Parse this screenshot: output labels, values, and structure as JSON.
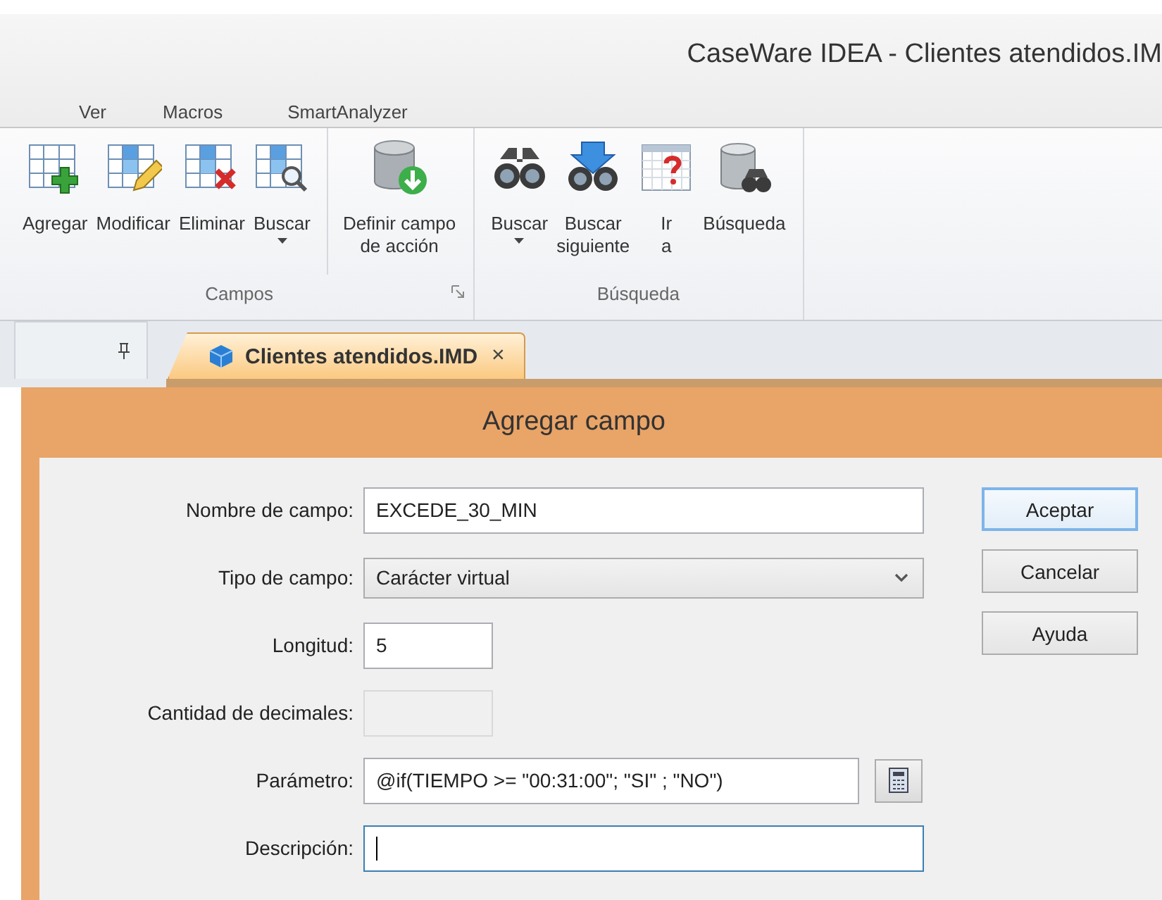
{
  "window": {
    "title": "CaseWare IDEA - Clientes atendidos.IM"
  },
  "menu": [
    "Ver",
    "Macros",
    "SmartAnalyzer"
  ],
  "ribbon": {
    "groups": [
      {
        "label": "Campos",
        "launcher": true,
        "sections": [
          {
            "buttons": [
              {
                "label": "Agregar",
                "has_menu": false
              },
              {
                "label": "Modificar",
                "has_menu": false
              },
              {
                "label": "Eliminar",
                "has_menu": false
              },
              {
                "label": "Buscar",
                "has_menu": true
              }
            ]
          },
          {
            "buttons": [
              {
                "label": "Definir campo\nde acción",
                "has_menu": false
              }
            ]
          }
        ]
      },
      {
        "label": "Búsqueda",
        "sections": [
          {
            "buttons": [
              {
                "label": "Buscar",
                "has_menu": true
              },
              {
                "label": "Buscar\nsiguiente",
                "has_menu": false
              },
              {
                "label": "Ir\na",
                "has_menu": false
              },
              {
                "label": "Búsqueda",
                "has_menu": false
              }
            ]
          }
        ]
      }
    ]
  },
  "tabs": [
    {
      "label": "Clientes atendidos.IMD",
      "selected": true,
      "close": "×"
    }
  ],
  "dialog": {
    "title": "Agregar campo",
    "fields": [
      {
        "label": "Nombre de campo:",
        "kind": "text",
        "value": "EXCEDE_30_MIN"
      },
      {
        "label": "Tipo de campo:",
        "kind": "select",
        "value": "Carácter virtual"
      },
      {
        "label": "Longitud:",
        "kind": "short",
        "value": "5"
      },
      {
        "label": "Cantidad de decimales:",
        "kind": "short",
        "disabled": true
      },
      {
        "label": "Parámetro:",
        "kind": "formula",
        "value": "@if(TIEMPO >= \"00:31:00\"; \"SI\" ; \"NO\")"
      },
      {
        "label": "Descripción:",
        "kind": "text",
        "focused": true
      }
    ],
    "buttons": [
      {
        "label": "Aceptar",
        "default": true
      },
      {
        "label": "Cancelar",
        "default": false
      },
      {
        "label": "Ayuda",
        "default": false
      }
    ]
  }
}
